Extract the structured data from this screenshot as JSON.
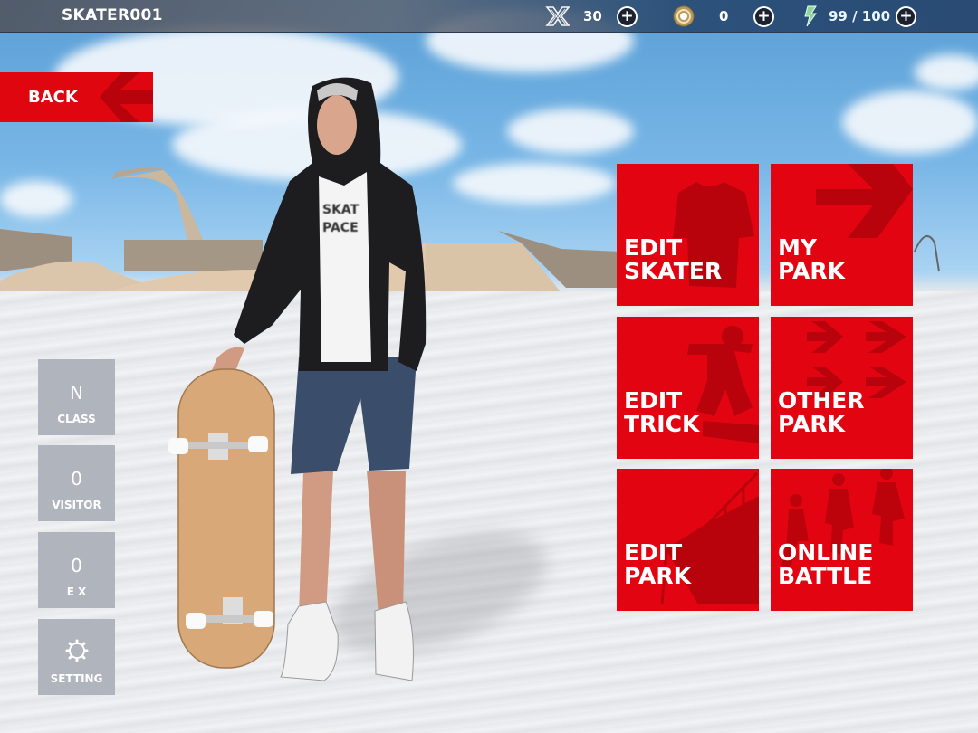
{
  "header": {
    "player_name": "SKATER001",
    "resources": [
      {
        "name": "x-points",
        "icon": "x-logo-icon",
        "value": "30"
      },
      {
        "name": "coins",
        "icon": "coin-icon",
        "value": "0"
      },
      {
        "name": "energy",
        "icon": "lightning-icon",
        "value": "99 / 100"
      }
    ],
    "plus_label": "+"
  },
  "back_button": {
    "label": "BACK"
  },
  "stats": [
    {
      "value": "N",
      "label": "CLASS"
    },
    {
      "value": "0",
      "label": "VISITOR"
    },
    {
      "value": "0",
      "label": "EX"
    },
    {
      "icon": "gear-icon",
      "label": "SETTING"
    }
  ],
  "menu": [
    {
      "line1": "EDIT",
      "line2": "SKATER",
      "icon": "tshirt-icon"
    },
    {
      "line1": "MY",
      "line2": "PARK",
      "icon": "arrow-right-icon"
    },
    {
      "line1": "EDIT",
      "line2": "TRICK",
      "icon": "skater-jump-icon"
    },
    {
      "line1": "OTHER",
      "line2": "PARK",
      "icon": "multi-arrow-icon"
    },
    {
      "line1": "EDIT",
      "line2": "PARK",
      "icon": "ramp-icon"
    },
    {
      "line1": "ONLINE",
      "line2": "BATTLE",
      "icon": "skaters-icon"
    }
  ],
  "scene": {
    "shirt_print": "SKAT PACE"
  },
  "colors": {
    "accent_red": "#e20511",
    "stat_gray": "#b0b5bd",
    "icon_shade": "#b8030c"
  }
}
